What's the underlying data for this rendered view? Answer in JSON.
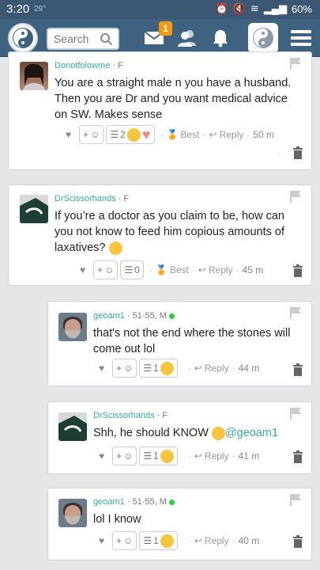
{
  "statusbar": {
    "time": "3:20",
    "temp": "29°",
    "battery": "60%"
  },
  "nav": {
    "search_placeholder": "Search",
    "mail_badge": "1"
  },
  "comments": [
    {
      "author": "Donotfolowme",
      "meta": "· F",
      "text": "You are a straight male n you have a husband. Then you are Dr and you want medical advice on SW. Makes sense",
      "reactions_count": "2",
      "best": "Best",
      "reply": "Reply",
      "time": "50 m"
    },
    {
      "author": "DrScissorhands",
      "meta": "· F",
      "text": "If you’re a doctor as you claim to be, how can you not know to feed him copious amounts of laxatives?",
      "reactions_count": "0",
      "best": "Best",
      "reply": "Reply",
      "time": "45 m"
    },
    {
      "author": "geoam1",
      "meta": "· 51-55, M",
      "text": "that's not the end where the stones will come out lol",
      "reactions_count": "1",
      "reply": "Reply",
      "time": "44 m"
    },
    {
      "author": "DrScissorhands",
      "meta": "· F",
      "text": "Shh, he should KNOW",
      "mention": "@geoam1",
      "reactions_count": "1",
      "reply": "Reply",
      "time": "41 m"
    },
    {
      "author": "geoam1",
      "meta": "· 51-55, M",
      "text": "lol I know",
      "reactions_count": "1",
      "reply": "Reply",
      "time": "40 m"
    }
  ],
  "add_reaction_label": "+",
  "colors": {
    "accent": "#3aa6a0",
    "nav": "#3f6281",
    "badge": "#f39c12",
    "online": "#2ecc40"
  }
}
